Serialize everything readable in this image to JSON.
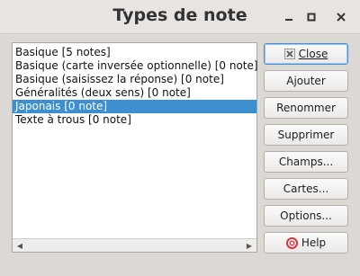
{
  "window": {
    "title": "Types de note",
    "controls": {
      "minimize": "minimize-icon",
      "maximize": "maximize-icon",
      "close": "close-icon"
    }
  },
  "note_types": [
    {
      "label": "Basique [5 notes]",
      "selected": false
    },
    {
      "label": "Basique (carte inversée optionnelle) [0 note]",
      "selected": false
    },
    {
      "label": "Basique (saisissez la réponse) [0 note]",
      "selected": false
    },
    {
      "label": "Généralités (deux sens) [0 note]",
      "selected": false
    },
    {
      "label": "Japonais [0 note]",
      "selected": true
    },
    {
      "label": "Texte à trous [0 note]",
      "selected": false
    }
  ],
  "buttons": {
    "close": {
      "label": "Close",
      "icon": "close-x-icon"
    },
    "add": "Ajouter",
    "rename": "Renommer",
    "delete": "Supprimer",
    "fields": "Champs...",
    "cards": "Cartes...",
    "options": "Options...",
    "help": {
      "label": "Help",
      "icon": "help-lifebuoy-icon"
    }
  },
  "colors": {
    "selection": "#3d8fd0",
    "default_button_border": "#4a90d9",
    "help_icon": "#d9343c"
  }
}
